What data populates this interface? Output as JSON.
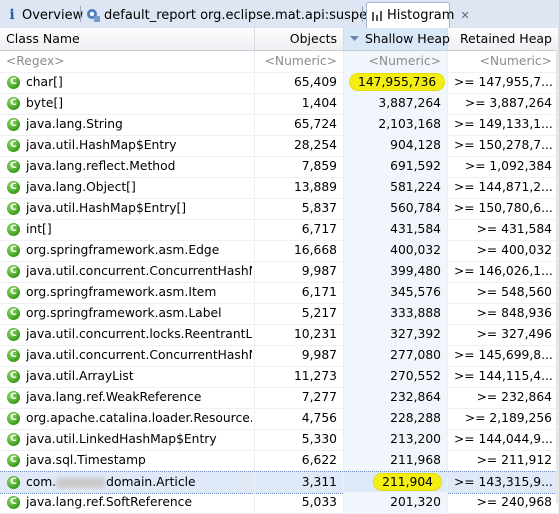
{
  "tabs": [
    {
      "label": "Overview",
      "icon": "info-icon"
    },
    {
      "label": "default_report  org.eclipse.mat.api:suspects",
      "icon": "report-icon"
    },
    {
      "label": "Histogram",
      "icon": "histogram-icon",
      "active": true
    }
  ],
  "columns": [
    "Class Name",
    "Objects",
    "Shallow Heap",
    "Retained Heap"
  ],
  "filter": {
    "name": "<Regex>",
    "objects": "<Numeric>",
    "shallow": "<Numeric>",
    "retained": "<Numeric>"
  },
  "rows": [
    {
      "name": "char[]",
      "objects": "65,409",
      "shallow": "147,955,736",
      "retained": ">= 147,955,7..."
    },
    {
      "name": "byte[]",
      "objects": "1,404",
      "shallow": "3,887,264",
      "retained": ">= 3,887,264"
    },
    {
      "name": "java.lang.String",
      "objects": "65,724",
      "shallow": "2,103,168",
      "retained": ">= 149,133,1..."
    },
    {
      "name": "java.util.HashMap$Entry",
      "objects": "28,254",
      "shallow": "904,128",
      "retained": ">= 150,278,7..."
    },
    {
      "name": "java.lang.reflect.Method",
      "objects": "7,859",
      "shallow": "691,592",
      "retained": ">= 1,092,384"
    },
    {
      "name": "java.lang.Object[]",
      "objects": "13,889",
      "shallow": "581,224",
      "retained": ">= 144,871,2..."
    },
    {
      "name": "java.util.HashMap$Entry[]",
      "objects": "5,837",
      "shallow": "560,784",
      "retained": ">= 150,780,6..."
    },
    {
      "name": "int[]",
      "objects": "6,717",
      "shallow": "431,584",
      "retained": ">= 431,584"
    },
    {
      "name": "org.springframework.asm.Edge",
      "objects": "16,668",
      "shallow": "400,032",
      "retained": ">= 400,032"
    },
    {
      "name": "java.util.concurrent.ConcurrentHashM...",
      "objects": "9,987",
      "shallow": "399,480",
      "retained": ">= 146,026,1..."
    },
    {
      "name": "org.springframework.asm.Item",
      "objects": "6,171",
      "shallow": "345,576",
      "retained": ">= 548,560"
    },
    {
      "name": "org.springframework.asm.Label",
      "objects": "5,217",
      "shallow": "333,888",
      "retained": ">= 848,936"
    },
    {
      "name": "java.util.concurrent.locks.ReentrantLo...",
      "objects": "10,231",
      "shallow": "327,392",
      "retained": ">= 327,496"
    },
    {
      "name": "java.util.concurrent.ConcurrentHashM...",
      "objects": "9,987",
      "shallow": "277,080",
      "retained": ">= 145,699,8..."
    },
    {
      "name": "java.util.ArrayList",
      "objects": "11,273",
      "shallow": "270,552",
      "retained": ">= 144,115,4..."
    },
    {
      "name": "java.lang.ref.WeakReference",
      "objects": "7,277",
      "shallow": "232,864",
      "retained": ">= 232,864"
    },
    {
      "name": "org.apache.catalina.loader.Resource...",
      "objects": "4,756",
      "shallow": "228,288",
      "retained": ">= 2,189,256"
    },
    {
      "name": "java.util.LinkedHashMap$Entry",
      "objects": "5,330",
      "shallow": "213,200",
      "retained": ">= 144,044,9..."
    },
    {
      "name": "java.sql.Timestamp",
      "objects": "6,622",
      "shallow": "211,968",
      "retained": ">= 211,912"
    },
    {
      "name_prefix": "com.",
      "name_suffix": "domain.Article",
      "objects": "3,311",
      "shallow": "211,904",
      "retained": ">= 143,315,9...",
      "selected": true
    },
    {
      "name": "java.lang.ref.SoftReference",
      "objects": "5,033",
      "shallow": "201,320",
      "retained": ">= 240,968"
    }
  ],
  "highlights": {
    "first_shallow": "147,955,736",
    "selected_shallow": "211,904"
  }
}
